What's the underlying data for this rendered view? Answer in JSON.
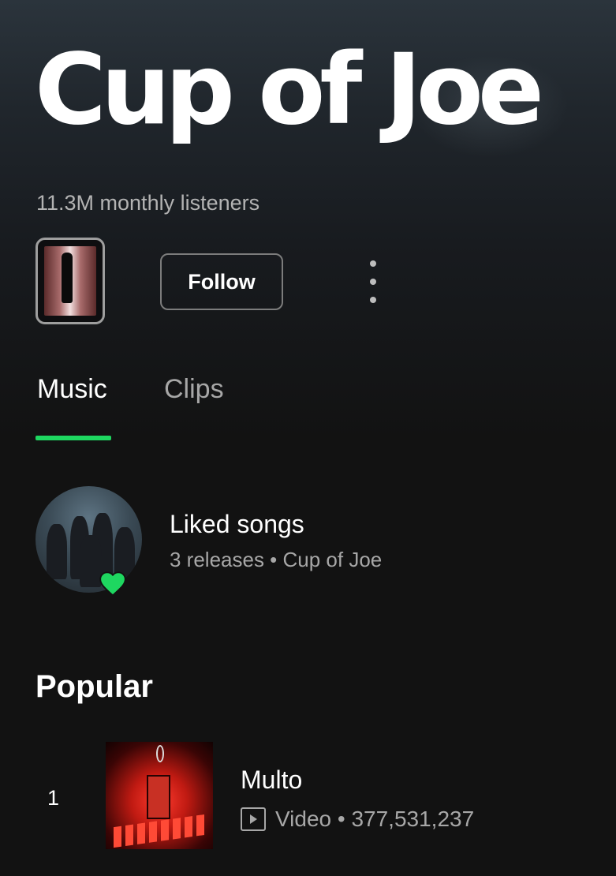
{
  "artist": {
    "name": "Cup of Joe",
    "monthly_listeners": "11.3M monthly listeners"
  },
  "actions": {
    "follow_label": "Follow",
    "more_icon": "more-vertical-icon"
  },
  "tabs": [
    {
      "label": "Music",
      "active": true
    },
    {
      "label": "Clips",
      "active": false
    }
  ],
  "liked": {
    "title": "Liked songs",
    "subtitle": "3 releases • Cup of Joe",
    "badge_icon": "heart-icon"
  },
  "popular": {
    "heading": "Popular",
    "tracks": [
      {
        "index": "1",
        "title": "Multo",
        "type": "Video",
        "plays": "377,531,237",
        "meta": "Video • 377,531,237"
      }
    ]
  },
  "colors": {
    "accent": "#1ed760",
    "background": "#121212",
    "text_secondary": "#a7a7a7"
  }
}
